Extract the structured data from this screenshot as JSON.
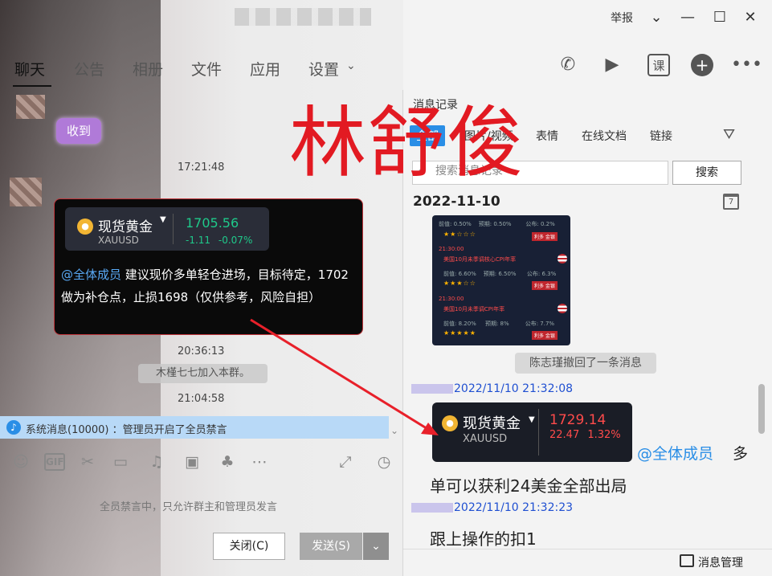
{
  "titlebar": {
    "report": "举报",
    "icons": [
      "chevron-down-icon",
      "minimize-icon",
      "maximize-icon",
      "close-icon"
    ]
  },
  "tabs": [
    {
      "label": "聊天",
      "active": true
    },
    {
      "label": "公告"
    },
    {
      "label": "相册"
    },
    {
      "label": "文件"
    },
    {
      "label": "应用"
    },
    {
      "label": "设置"
    }
  ],
  "toolbar": {
    "course": "课"
  },
  "chat": {
    "badge": "收到",
    "time1": "17:21:48",
    "quote": {
      "name": "现货黄金",
      "code": "XAUUSD",
      "price": "1705.56",
      "change": "-1.11",
      "pct": "-0.07%",
      "color": "#1fc98a"
    },
    "mention": "@全体成员",
    "message": "建议现价多单轻仓进场，目标待定，1702做为补仓点，止损1698（仅供参考，风险自担）",
    "time2": "20:36:13",
    "join": "木槿七七加入本群。",
    "time3": "21:04:58",
    "system_notice": "系统消息(10000) ：管理员开启了全员禁言"
  },
  "composer": {
    "gif": "GIF",
    "hint": "全员禁言中，只允许群主和管理员发言",
    "close_label": "关闭(C)",
    "send_label": "发送(S)"
  },
  "history": {
    "title": "消息记录",
    "tabs": [
      "全部",
      "图片/视频",
      "表情",
      "在线文档",
      "链接"
    ],
    "search_placeholder": "搜索消息记录",
    "search_button": "搜索",
    "date": "2022-11-10",
    "calendar_icon_text": "7",
    "calendar_image": {
      "rows": [
        {
          "text": "前值: 0.50%",
          "text2": "预期: 0.50%",
          "text3": "公布: 0.2%"
        },
        {
          "time": "21:30:00",
          "title": "美国10月未季调核心CPI年率",
          "prev": "前值: 6.60%",
          "exp": "预期: 6.50%",
          "pub": "公布: 6.3%"
        },
        {
          "time": "21:30:00",
          "title": "美国10月未季调CPI年率",
          "prev": "前值: 8.20%",
          "exp": "预期: 8%",
          "pub": "公布: 7.7%"
        }
      ],
      "tag": "利多 金银"
    },
    "recall": "陈志瑾撤回了一条消息",
    "msg1_time": "2022/11/10 21:32:08",
    "quote2": {
      "name": "现货黄金",
      "code": "XAUUSD",
      "price": "1729.14",
      "change": "22.47",
      "pct": "1.32%",
      "color": "#ff4b4b"
    },
    "mention": "@全体成员",
    "duo": "多",
    "msg1_text": "单可以获利24美金全部出局",
    "msg2_time": "2022/11/10 21:32:23",
    "msg2_text": "跟上操作的扣1",
    "footer": "消息管理"
  },
  "watermark": "林舒俊"
}
